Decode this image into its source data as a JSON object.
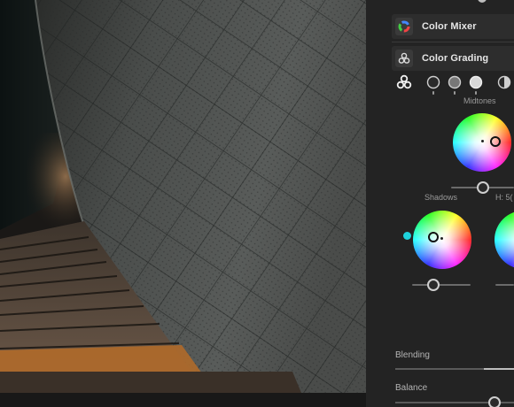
{
  "panel": {
    "color_mixer_label": "Color Mixer",
    "color_grading_label": "Color Grading",
    "midtones_label": "Midtones",
    "shadows_label": "Shadows",
    "hue_readout": "H: 5(",
    "blending_label": "Blending",
    "balance_label": "Balance"
  },
  "icons": {
    "color_mixer": "color-wheel-icon",
    "color_grading": "three-circles-icon",
    "modes": [
      "three-circles-icon",
      "shadows-circle-icon",
      "midtones-circle-icon",
      "highlights-circle-icon",
      "global-half-circle-icon"
    ]
  },
  "colors": {
    "panel_bg": "#232323",
    "row_bg": "#2d2d2d",
    "text": "#e6e6e6",
    "muted_text": "#9a9a9a",
    "accent_cyan": "#1ed2dc"
  }
}
